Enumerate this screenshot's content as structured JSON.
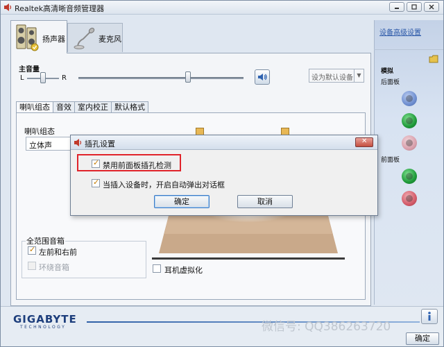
{
  "window": {
    "title": "Realtek高清晰音频管理器",
    "buttons": [
      "minimize",
      "restore",
      "close"
    ]
  },
  "device_tabs": [
    {
      "label": "扬声器",
      "active": true,
      "icon": "speaker-icon"
    },
    {
      "label": "麦克风",
      "active": false,
      "icon": "microphone-icon"
    }
  ],
  "volume": {
    "label": "主音量",
    "left": "L",
    "right": "R",
    "mute_icon": "speaker-volume-icon",
    "default_device": "设为默认设备"
  },
  "sub_tabs": [
    "喇叭组态",
    "音效",
    "室内校正",
    "默认格式"
  ],
  "speaker_config": {
    "label": "喇叭组态",
    "value": "立体声"
  },
  "full_range": {
    "label": "全范围音箱",
    "options": [
      {
        "label": "左前和右前",
        "checked": true,
        "enabled": true
      },
      {
        "label": "环绕音箱",
        "checked": false,
        "enabled": false
      }
    ]
  },
  "headphone_virtualization": {
    "label": "耳机虚拟化",
    "checked": false
  },
  "side_panel": {
    "advanced_link": "设备高级设置",
    "analog_label": "模拟",
    "rear_label": "后面板",
    "front_label": "前面板",
    "rear_jacks": [
      "blue",
      "green",
      "pink"
    ],
    "front_jacks": [
      "green",
      "pink"
    ]
  },
  "dialog": {
    "title": "插孔设置",
    "option1": "禁用前面板插孔检测",
    "option1_checked": true,
    "option2": "当插入设备时，开启自动弹出对话框",
    "option2_checked": true,
    "ok": "确定",
    "cancel": "取消"
  },
  "footer": {
    "brand": "GIGABYTE",
    "brand_sub": "TECHNOLOGY",
    "ok": "确定",
    "watermark": "微信号: QQ386263720"
  },
  "colors": {
    "accent": "#2a57a8",
    "highlight": "#e0232a",
    "jack_blue": "#6f8fd0",
    "jack_green": "#1f9a3a",
    "jack_pink": "#d9a1ad",
    "front_pink": "#d35c6a"
  }
}
